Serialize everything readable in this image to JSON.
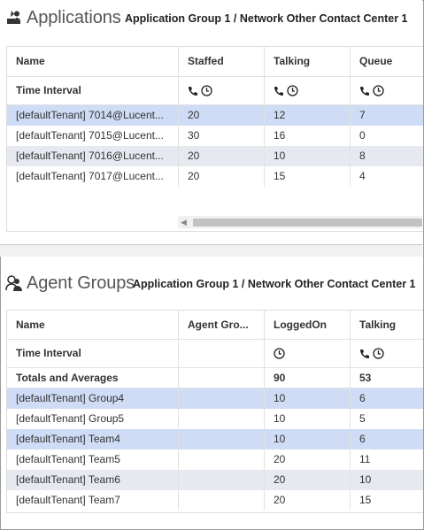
{
  "applications": {
    "title": "Applications",
    "breadcrumb": "Application Group 1 / Network Other Contact Center 1",
    "columns": [
      "Name",
      "Staffed",
      "Talking",
      "Queue"
    ],
    "time_interval_label": "Time Interval",
    "rows": [
      {
        "name": "[defaultTenant] 7014@Lucent...",
        "staffed": "20",
        "talking": "12",
        "queue": "7"
      },
      {
        "name": "[defaultTenant] 7015@Lucent...",
        "staffed": "30",
        "talking": "16",
        "queue": "0"
      },
      {
        "name": "[defaultTenant] 7016@Lucent...",
        "staffed": "20",
        "talking": "10",
        "queue": "8"
      },
      {
        "name": "[defaultTenant] 7017@Lucent...",
        "staffed": "20",
        "talking": "15",
        "queue": "4"
      }
    ]
  },
  "agent_groups": {
    "title": "Agent Groups",
    "breadcrumb": "Application Group 1 / Network Other Contact Center 1",
    "columns": [
      "Name",
      "Agent Gro...",
      "LoggedOn",
      "Talking"
    ],
    "time_interval_label": "Time Interval",
    "totals": {
      "label": "Totals and Averages",
      "loggedon": "90",
      "talking": "53"
    },
    "rows": [
      {
        "name": "[defaultTenant] Group4",
        "loggedon": "10",
        "talking": "6"
      },
      {
        "name": "[defaultTenant] Group5",
        "loggedon": "10",
        "talking": "5"
      },
      {
        "name": "[defaultTenant] Team4",
        "loggedon": "10",
        "talking": "6"
      },
      {
        "name": "[defaultTenant] Team5",
        "loggedon": "20",
        "talking": "11"
      },
      {
        "name": "[defaultTenant] Team6",
        "loggedon": "20",
        "talking": "10"
      },
      {
        "name": "[defaultTenant] Team7",
        "loggedon": "20",
        "talking": "15"
      }
    ]
  },
  "icons": {
    "applications": "applications-icon",
    "agent_groups": "agent-groups-icon",
    "phone": "phone-icon",
    "clock": "clock-icon",
    "scroll_left": "scroll-left-arrow-icon"
  },
  "colors": {
    "selected_row": "#cfdcf5",
    "alternate_row": "#e6eaf0"
  }
}
